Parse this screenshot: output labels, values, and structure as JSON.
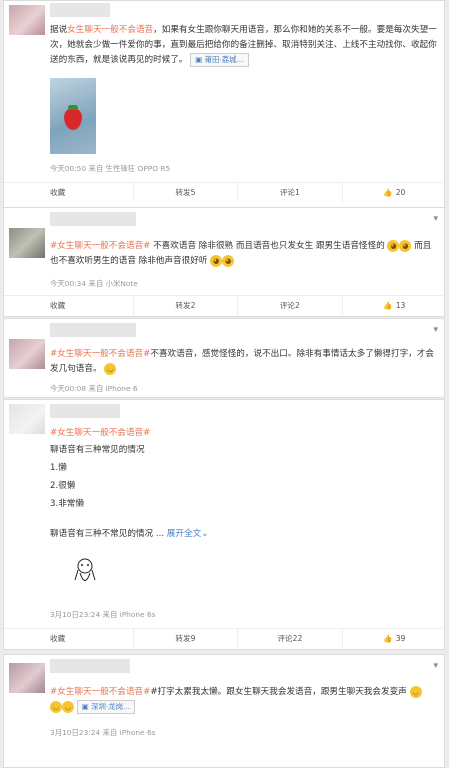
{
  "posts": [
    {
      "text_prefix": "据说",
      "tag": "女生聊天一般不会语音",
      "text_main": "，如果有女生跟你聊天用语音，那么你和她的关系不一般。要是每次失望一次，她就会少做一件爱你的事，直到最后把给你的备注删掉、取消特别关注、上线不主动找你、收起你送的东西，就是该说再见的时候了。",
      "location": "莆田·荔城...",
      "meta": "今天00:50 来自 生性锋狂 OPPO R5",
      "actions": {
        "collect": "收藏",
        "forward": "转发5",
        "comment": "评论1",
        "like": "20"
      }
    },
    {
      "tag": "#女生聊天一般不会语音#",
      "text_main": "不喜欢语音 除非很熟 而且语音也只发女生 跟男生语音怪怪的",
      "text_cont": "而且也不喜欢听男生的语音 除非他声音很好听",
      "meta": "今天00:34 来自 小米Note",
      "actions": {
        "collect": "收藏",
        "forward": "转发2",
        "comment": "评论2",
        "like": "13"
      }
    },
    {
      "tag": "#女生聊天一般不会语音#",
      "text_main": "不喜欢语音，感觉怪怪的，说不出口。除非有事情话太多了懒得打字，才会发几句语音。",
      "meta": "今天00:08 来自 iPhone 6"
    },
    {
      "tag": "#女生聊天一般不会语音#",
      "lines": [
        "聊语音有三种常见的情况",
        "1.懒",
        "2.很懒",
        "3.非常懒"
      ],
      "summary": "聊语音有三种不常见的情况 ...",
      "expand": "展开全文",
      "meta": "3月10日23:24 来自 iPhone 6s",
      "actions": {
        "collect": "收藏",
        "forward": "转发9",
        "comment": "评论22",
        "like": "39"
      }
    },
    {
      "tag": "#女生聊天一般不会语音#",
      "text_main": "#打字太累我太懒。跟女生聊天我会发语音，跟男生聊天我会发变声",
      "location": "深圳·龙岗...",
      "meta": "3月10日23:24 来自 iPhone 6s"
    }
  ]
}
